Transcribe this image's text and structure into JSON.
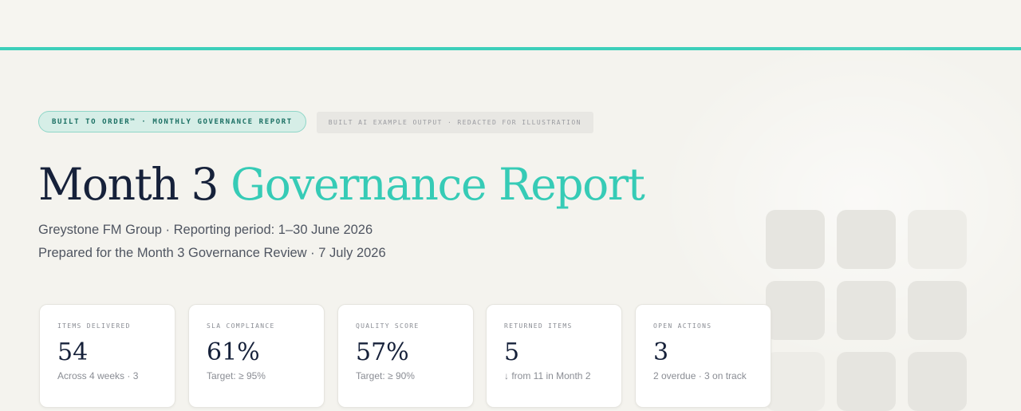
{
  "badges": {
    "primary": "BUILT TO ORDER™ · MONTHLY GOVERNANCE REPORT",
    "secondary": "BUILT AI EXAMPLE OUTPUT · REDACTED FOR ILLUSTRATION"
  },
  "title": {
    "part1": "Month 3",
    "part2": "Governance Report"
  },
  "meta": {
    "line1": "Greystone FM Group · Reporting period: 1–30 June 2026",
    "line2": "Prepared for the Month 3 Governance Review · 7 July 2026"
  },
  "kpis": [
    {
      "label": "ITEMS DELIVERED",
      "value": "54",
      "sub": "Across 4 weeks · 3"
    },
    {
      "label": "SLA COMPLIANCE",
      "value": "61%",
      "sub": "Target: ≥ 95%"
    },
    {
      "label": "QUALITY SCORE",
      "value": "57%",
      "sub": "Target: ≥ 90%"
    },
    {
      "label": "RETURNED ITEMS",
      "value": "5",
      "sub": "↓ from 11 in Month 2"
    },
    {
      "label": "OPEN ACTIONS",
      "value": "3",
      "sub": "2 overdue · 3 on track"
    }
  ],
  "colors": {
    "accent": "#3ccfba",
    "title_accent": "#36cbb6",
    "navy": "#16213a",
    "background": "#f4f3ee"
  }
}
